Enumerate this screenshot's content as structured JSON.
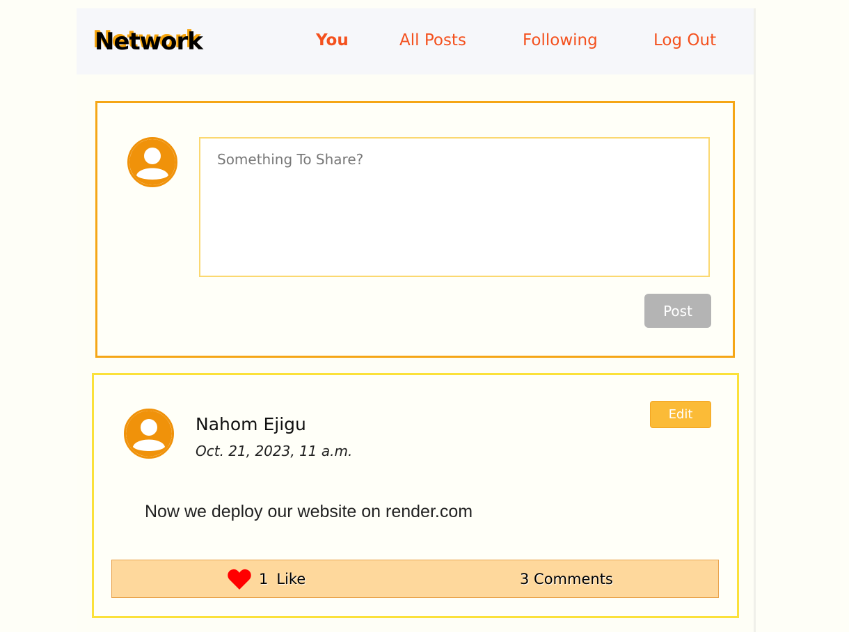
{
  "navbar": {
    "brand": "Network",
    "links": [
      {
        "label": "You"
      },
      {
        "label": "All Posts"
      },
      {
        "label": "Following"
      },
      {
        "label": "Log Out"
      }
    ]
  },
  "compose": {
    "placeholder": "Something To Share?",
    "value": "",
    "post_label": "Post"
  },
  "post": {
    "author": "Nahom Ejigu",
    "date": "Oct. 21, 2023, 11 a.m.",
    "content": "Now we deploy our website on render.com",
    "edit_label": "Edit",
    "like_count": "1",
    "like_label": "Like",
    "comments_label": "3 Comments"
  },
  "colors": {
    "accent": "#f4511e",
    "brand_shadow": "#f5a40c",
    "compose_border": "#f5a616",
    "card_border": "#fbe13a",
    "footer_bg": "#fed89c",
    "avatar": "#f0920a",
    "heart": "#ff0000"
  },
  "icons": {
    "avatar": "user-avatar-icon",
    "like": "heart-icon"
  }
}
